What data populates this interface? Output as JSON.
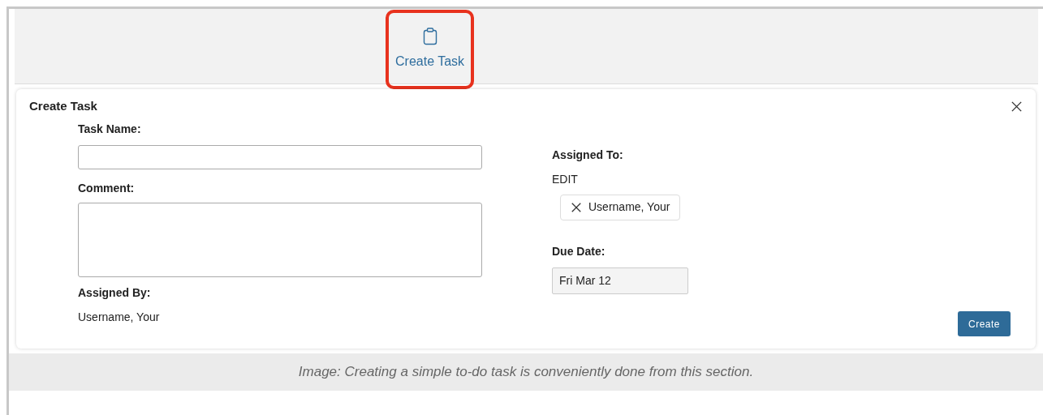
{
  "toolbar": {
    "items": [
      {
        "label": "Create Task",
        "highlighted": true
      }
    ]
  },
  "dialog": {
    "title": "Create Task",
    "task_name": {
      "label": "Task Name:"
    },
    "comment": {
      "label": "Comment:"
    },
    "assigned_by": {
      "label": "Assigned By:",
      "value": "Username, Your"
    },
    "assigned_to": {
      "label": "Assigned To:",
      "action": "EDIT",
      "chips": [
        "Username, Your"
      ]
    },
    "due_date": {
      "label": "Due Date:",
      "value": "Fri Mar 12"
    },
    "submit": "Create"
  },
  "caption": "Image: Creating a simple to-do task is conveniently done from this section."
}
